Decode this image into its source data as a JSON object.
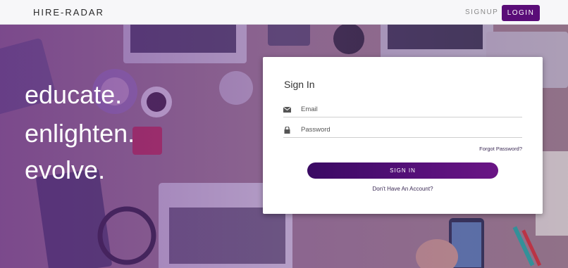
{
  "navbar": {
    "brand": "HIRE-RADAR",
    "signup_label": "SIGNUP",
    "login_label": "LOGIN"
  },
  "hero": {
    "taglines": [
      "educate.",
      "enlighten.",
      "evolve."
    ]
  },
  "signin": {
    "title": "Sign In",
    "email_placeholder": "Email",
    "email_icon": "envelope-icon",
    "password_placeholder": "Password",
    "password_icon": "lock-icon",
    "forgot_label": "Forgot Password?",
    "button_label": "SIGN IN",
    "no_account_label": "Don't Have An Account?"
  },
  "colors": {
    "accent": "#5a0d78",
    "button_gradient_start": "#3a0a63",
    "button_gradient_end": "#6a1585",
    "hero_tint": "#6a3e8c"
  }
}
